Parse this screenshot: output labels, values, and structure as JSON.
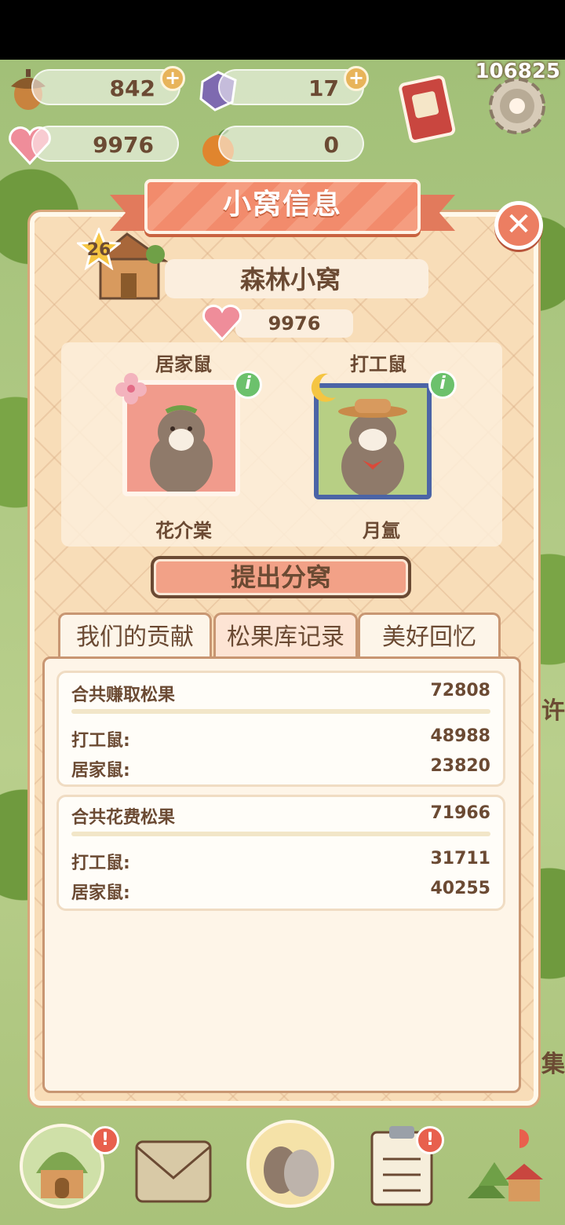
{
  "resources": {
    "acorns": "842",
    "gems": "17",
    "hearts": "9976",
    "oranges": "0"
  },
  "top_code": "106825",
  "dialog": {
    "title": "小窝信息",
    "level": "26",
    "home_name": "森林小窝",
    "heart_value": "9976",
    "occupants": [
      {
        "role": "居家鼠",
        "name": "花介棠"
      },
      {
        "role": "打工鼠",
        "name": "月氲"
      }
    ],
    "propose_button": "提出分窝",
    "tabs": [
      "我们的贡献",
      "松果库记录",
      "美好回忆"
    ],
    "earned": {
      "title": "合共赚取松果",
      "total": "72808",
      "rows": [
        {
          "k": "打工鼠:",
          "v": "48988"
        },
        {
          "k": "居家鼠:",
          "v": "23820"
        }
      ]
    },
    "spent": {
      "title": "合共花费松果",
      "total": "71966",
      "rows": [
        {
          "k": "打工鼠:",
          "v": "31711"
        },
        {
          "k": "居家鼠:",
          "v": "40255"
        }
      ]
    }
  },
  "side_chars": [
    "许",
    "集"
  ]
}
